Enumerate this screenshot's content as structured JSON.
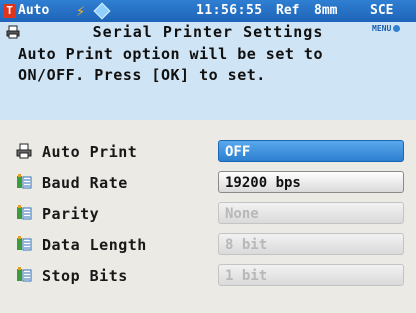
{
  "status_bar": {
    "mode_icon": "T",
    "mode": "Auto",
    "flash_icon": "lightning-icon",
    "link_icon": "diamond-link-icon",
    "clock": "11:56:55",
    "reference": "Ref",
    "aperture": "8mm",
    "specular": "SCE"
  },
  "header": {
    "title": "Serial Printer Settings",
    "menu_label": "MENU",
    "message_line1": "Auto Print option will be set to",
    "message_line2": "ON/OFF. Press [OK] to set."
  },
  "settings": [
    {
      "label": "Auto Print",
      "value": "OFF",
      "icon": "printer-icon",
      "state": "selected"
    },
    {
      "label": "Baud Rate",
      "value": "19200 bps",
      "icon": "list-icon",
      "state": "active"
    },
    {
      "label": "Parity",
      "value": "None",
      "icon": "list-icon",
      "state": "disabled"
    },
    {
      "label": "Data Length",
      "value": "8 bit",
      "icon": "list-icon",
      "state": "disabled"
    },
    {
      "label": "Stop Bits",
      "value": "1 bit",
      "icon": "list-icon",
      "state": "disabled"
    }
  ],
  "colors": {
    "status_bar": "#1e64b8",
    "header_bg": "#cfe4f4",
    "selected": "#2c7fd0",
    "screen_bg": "#eceae4"
  }
}
